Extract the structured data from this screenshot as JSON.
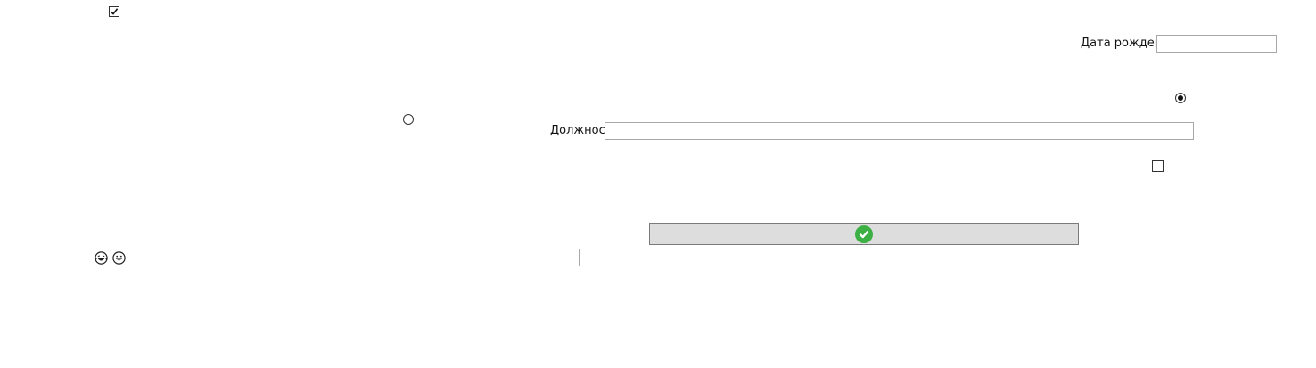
{
  "form": {
    "agree_checkbox": {
      "checked": true
    },
    "birth_date": {
      "label": "Дата рождения",
      "value": ""
    },
    "radio_option_1": {
      "checked": false
    },
    "radio_option_2": {
      "checked": true
    },
    "position": {
      "label": "Должность",
      "value": ""
    },
    "extra_checkbox": {
      "checked": false
    },
    "submit_button": {
      "icon": "check-circle-icon",
      "label": ""
    },
    "comment": {
      "icons": [
        "laughing-face-icon",
        "grinning-face-icon"
      ],
      "value": ""
    }
  },
  "colors": {
    "accent_green": "#3cb043",
    "button_bg": "#dddddd",
    "field_border": "#a8a8a8"
  }
}
